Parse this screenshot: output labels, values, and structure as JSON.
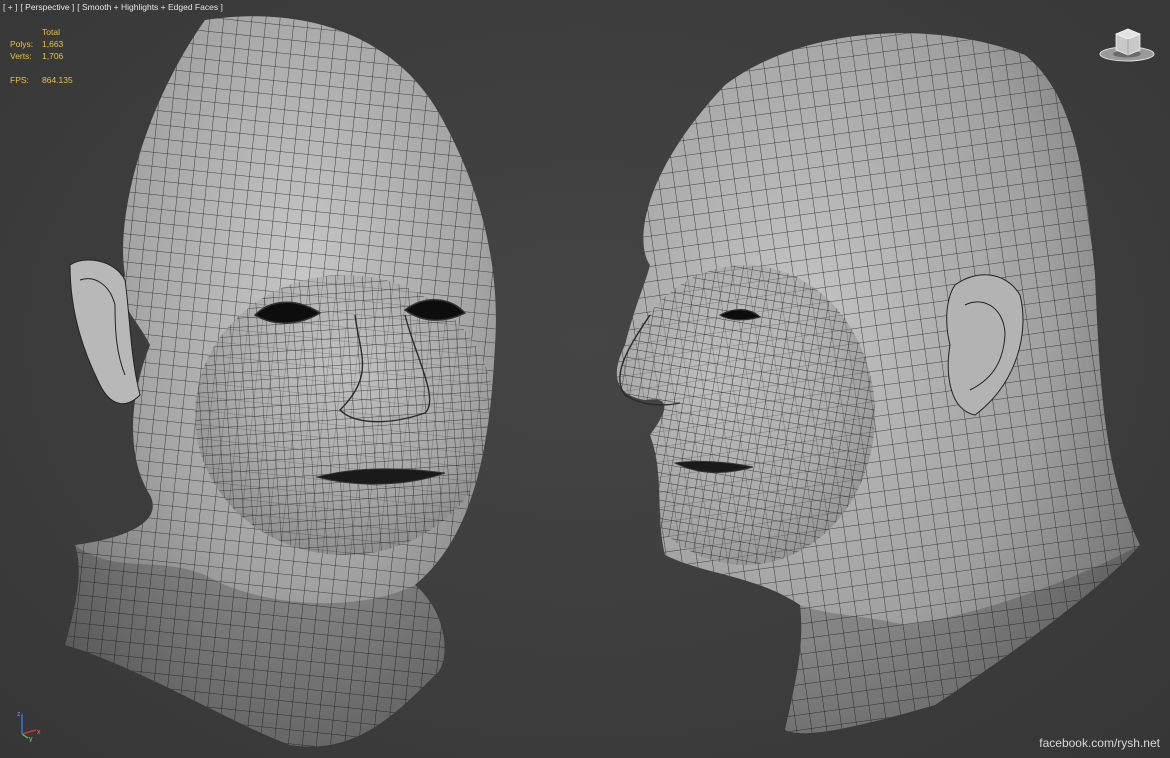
{
  "viewport": {
    "labels": [
      "[ + ]",
      "[ Perspective ]",
      "[ Smooth + Highlights + Edged Faces ]"
    ],
    "stats": {
      "header": "Total",
      "polys_label": "Polys:",
      "polys_value": "1,663",
      "verts_label": "Verts:",
      "verts_value": "1,706",
      "fps_label": "FPS:",
      "fps_value": "864.135"
    },
    "axis_labels": {
      "x": "x",
      "y": "y",
      "z": "z"
    }
  },
  "watermark": "facebook.com/rysh.net",
  "colors": {
    "background": "#3d3d3d",
    "stats_text": "#e8c33a",
    "label_text": "#e6e6e6",
    "mesh_fill": "#a9a9a9",
    "wire": "#1e1e1e"
  },
  "icons": [
    "viewcube-icon",
    "axis-tripod-icon"
  ]
}
